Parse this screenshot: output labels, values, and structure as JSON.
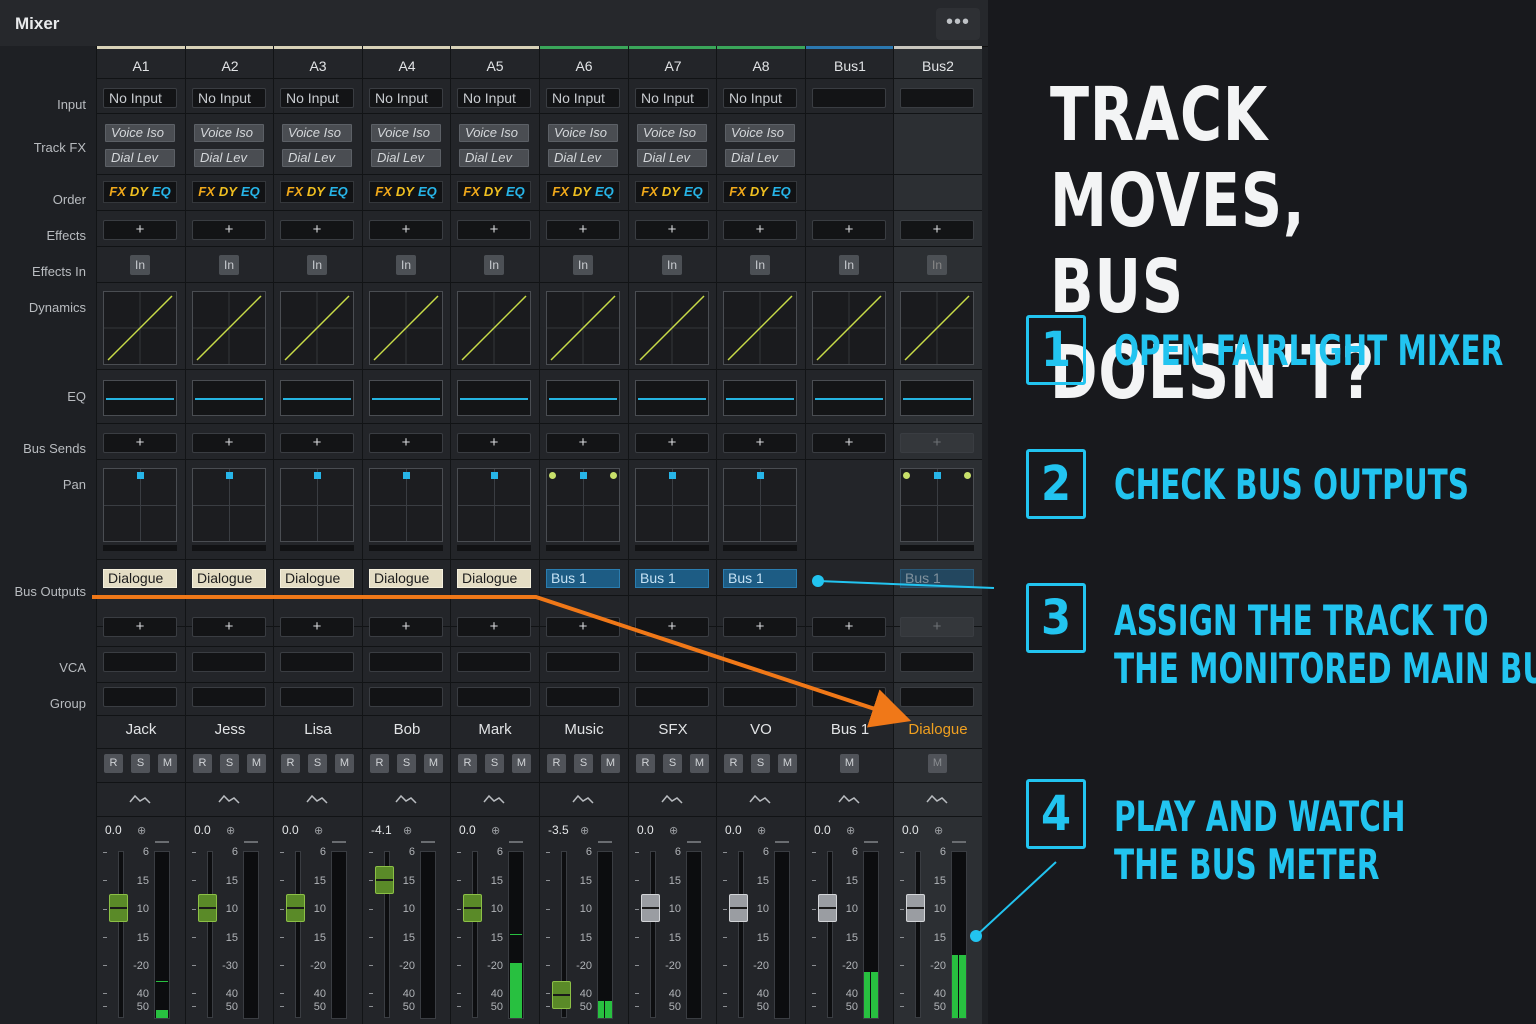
{
  "window": {
    "title": "Mixer",
    "menu_icon": "more-dots-icon"
  },
  "row_labels": [
    "Input",
    "Track FX",
    "Order",
    "Effects",
    "Effects In",
    "Dynamics",
    "EQ",
    "Bus Sends",
    "Pan",
    "Bus Outputs",
    "VCA",
    "Group"
  ],
  "colors": {
    "accent": "#22c4f0",
    "highlight_orange": "#f07818",
    "meter_green": "#28c040",
    "dialogue_tag": "#e4ddc4",
    "bus_tag": "#1d5c84"
  },
  "channels": [
    {
      "id": "A1",
      "input": "No Input",
      "fx": [
        "Voice Iso",
        "Dial Lev"
      ],
      "order": [
        "FX",
        "DY",
        "EQ"
      ],
      "effects": "+",
      "effects_in": "In",
      "bus_sends": "+",
      "pan": "mono",
      "bus_output": "Dialogue",
      "bus_add": "+",
      "name": "Jack",
      "buttons": [
        "R",
        "S",
        "M"
      ],
      "volume": "0.0",
      "fader_db": "-10",
      "scale": [
        "6",
        "15",
        "10",
        "15",
        "-20",
        "40",
        "50"
      ],
      "meter": 0.05
    },
    {
      "id": "A2",
      "input": "No Input",
      "fx": [
        "Voice Iso",
        "Dial Lev"
      ],
      "order": [
        "FX",
        "DY",
        "EQ"
      ],
      "effects": "+",
      "effects_in": "In",
      "bus_sends": "+",
      "pan": "mono",
      "bus_output": "Dialogue",
      "bus_add": "+",
      "name": "Jess",
      "buttons": [
        "R",
        "S",
        "M"
      ],
      "volume": "0.0",
      "fader_db": "-10",
      "scale": [
        "6",
        "15",
        "10",
        "15",
        "-30",
        "40",
        "50"
      ],
      "meter": 0
    },
    {
      "id": "A3",
      "input": "No Input",
      "fx": [
        "Voice Iso",
        "Dial Lev"
      ],
      "order": [
        "FX",
        "DY",
        "EQ"
      ],
      "effects": "+",
      "effects_in": "In",
      "bus_sends": "+",
      "pan": "mono",
      "bus_output": "Dialogue",
      "bus_add": "+",
      "name": "Lisa",
      "buttons": [
        "R",
        "S",
        "M"
      ],
      "volume": "0.0",
      "fader_db": "-10",
      "scale": [
        "6",
        "15",
        "10",
        "15",
        "-20",
        "40",
        "50"
      ],
      "meter": 0
    },
    {
      "id": "A4",
      "input": "No Input",
      "fx": [
        "Voice Iso",
        "Dial Lev"
      ],
      "order": [
        "FX",
        "DY",
        "EQ"
      ],
      "effects": "+",
      "effects_in": "In",
      "bus_sends": "+",
      "pan": "mono",
      "bus_output": "Dialogue",
      "bus_add": "+",
      "name": "Bob",
      "buttons": [
        "R",
        "S",
        "M"
      ],
      "volume": "-4.1",
      "fader_db": "-15",
      "scale": [
        "6",
        "15",
        "10",
        "15",
        "-20",
        "40",
        "50"
      ],
      "meter": 0
    },
    {
      "id": "A5",
      "input": "No Input",
      "fx": [
        "Voice Iso",
        "Dial Lev"
      ],
      "order": [
        "FX",
        "DY",
        "EQ"
      ],
      "effects": "+",
      "effects_in": "In",
      "bus_sends": "+",
      "pan": "mono",
      "bus_output": "Dialogue",
      "bus_add": "+",
      "name": "Mark",
      "buttons": [
        "R",
        "S",
        "M"
      ],
      "volume": "0.0",
      "fader_db": "-10",
      "scale": [
        "6",
        "15",
        "10",
        "15",
        "-20",
        "40",
        "50"
      ],
      "meter": 0.33
    },
    {
      "id": "A6",
      "input": "No Input",
      "fx": [
        "Voice Iso",
        "Dial Lev"
      ],
      "order": [
        "FX",
        "DY",
        "EQ"
      ],
      "effects": "+",
      "effects_in": "In",
      "bus_sends": "+",
      "pan": "stereo",
      "bus_output": "Bus 1",
      "bus_add": "+",
      "name": "Music",
      "buttons": [
        "R",
        "S",
        "M"
      ],
      "volume": "-3.5",
      "fader_db": "-50",
      "scale": [
        "6",
        "15",
        "10",
        "15",
        "-20",
        "40",
        "50"
      ],
      "meter": 0.1
    },
    {
      "id": "A7",
      "input": "No Input",
      "fx": [
        "Voice Iso",
        "Dial Lev"
      ],
      "order": [
        "FX",
        "DY",
        "EQ"
      ],
      "effects": "+",
      "effects_in": "In",
      "bus_sends": "+",
      "pan": "mono",
      "bus_output": "Bus 1",
      "bus_add": "+",
      "name": "SFX",
      "buttons": [
        "R",
        "S",
        "M"
      ],
      "volume": "0.0",
      "fader_db": "-10",
      "scale": [
        "6",
        "15",
        "10",
        "15",
        "-20",
        "40",
        "50"
      ],
      "meter": 0
    },
    {
      "id": "A8",
      "input": "No Input",
      "fx": [
        "Voice Iso",
        "Dial Lev"
      ],
      "order": [
        "FX",
        "DY",
        "EQ"
      ],
      "effects": "+",
      "effects_in": "In",
      "bus_sends": "+",
      "pan": "mono",
      "bus_output": "Bus 1",
      "bus_add": "+",
      "name": "VO",
      "buttons": [
        "R",
        "S",
        "M"
      ],
      "volume": "0.0",
      "fader_db": "-10",
      "scale": [
        "6",
        "15",
        "10",
        "15",
        "-20",
        "40",
        "50"
      ],
      "meter": 0
    },
    {
      "id": "Bus1",
      "input": "",
      "fx": [],
      "order": [],
      "effects": "+",
      "effects_in": "In",
      "bus_sends": "+",
      "pan": "none",
      "bus_output": "",
      "bus_add": "+",
      "name": "Bus 1",
      "buttons": [
        "M"
      ],
      "volume": "0.0",
      "fader_db": "-10",
      "scale": [
        "6",
        "15",
        "10",
        "15",
        "-20",
        "40",
        "50"
      ],
      "meter": 0.28
    },
    {
      "id": "Bus2",
      "input": "",
      "fx": [],
      "order": [],
      "effects": "+",
      "effects_in": "In",
      "bus_sends": "+",
      "pan": "stereo",
      "bus_output": "Bus 1",
      "bus_add": "+",
      "name": "Dialogue",
      "buttons": [
        "M"
      ],
      "volume": "0.0",
      "fader_db": "-10",
      "scale": [
        "6",
        "15",
        "10",
        "15",
        "-20",
        "40",
        "50"
      ],
      "meter": 0.38
    }
  ],
  "headline": [
    "TRACK MOVES,",
    "BUS DOESN’T?"
  ],
  "steps": [
    {
      "number": "1",
      "lines": [
        "OPEN FAIRLIGHT MIXER"
      ]
    },
    {
      "number": "2",
      "lines": [
        "CHECK BUS OUTPUTS"
      ]
    },
    {
      "number": "3",
      "lines": [
        "ASSIGN THE TRACK TO",
        "THE MONITORED MAIN BUS"
      ]
    },
    {
      "number": "4",
      "lines": [
        "PLAY AND WATCH",
        "THE BUS METER"
      ]
    }
  ]
}
